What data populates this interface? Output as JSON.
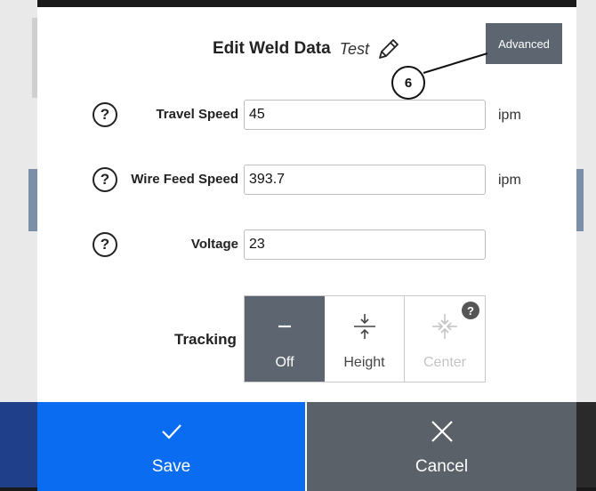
{
  "dialog": {
    "title": "Edit Weld Data",
    "subtitle": "Test",
    "edit_icon": "pencil-icon",
    "advanced_label": "Advanced",
    "callout_number": "6"
  },
  "fields": [
    {
      "label": "Travel Speed",
      "value": "45",
      "unit": "ipm",
      "help_icon": "question-circle-icon"
    },
    {
      "label": "Wire Feed Speed",
      "value": "393.7",
      "unit": "ipm",
      "help_icon": "question-circle-icon"
    },
    {
      "label": "Voltage",
      "value": "23",
      "unit": "",
      "help_icon": "question-circle-icon"
    }
  ],
  "tracking": {
    "label": "Tracking",
    "options": [
      {
        "label": "Off",
        "icon": "minus-icon",
        "selected": true,
        "enabled": true
      },
      {
        "label": "Height",
        "icon": "height-tracking-icon",
        "selected": false,
        "enabled": true
      },
      {
        "label": "Center",
        "icon": "center-tracking-icon",
        "selected": false,
        "enabled": false,
        "badge": "?"
      }
    ]
  },
  "actions": {
    "save_label": "Save",
    "save_icon": "check-icon",
    "cancel_label": "Cancel",
    "cancel_icon": "close-icon"
  },
  "colors": {
    "save": "#0a6cf0",
    "cancel": "#5a6168",
    "selected_segment": "#5d6670",
    "advanced": "#5d6670"
  }
}
